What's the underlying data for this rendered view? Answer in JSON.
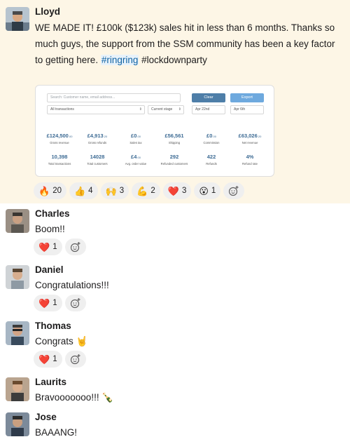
{
  "messages": [
    {
      "author": "Lloyd",
      "text_parts": [
        "WE MADE IT! £100k ($123k) sales hit in less than 6 months. Thanks so much guys, the support from the SSM community has been a key factor to getting here. ",
        "#ringring",
        " #lockdownparty"
      ],
      "attachment": {
        "search_placeholder": "Search: Customer name, email address...",
        "clear_label": "Clear",
        "export_label": "Export",
        "filter_transactions": "All transactions",
        "filter_stage": "Current stage",
        "date_from": "Apr 22nd",
        "date_to": "Apr 6th",
        "stats_row1": [
          {
            "value": "£124,500",
            "suffix": ".00",
            "label": "Gross revenue"
          },
          {
            "value": "£4,913",
            "suffix": ".20",
            "label": "Gross refunds"
          },
          {
            "value": "£0",
            "suffix": ".00",
            "label": "Sales tax"
          },
          {
            "value": "£56,561",
            "suffix": "",
            "label": "Shipping"
          },
          {
            "value": "£0",
            "suffix": ".00",
            "label": "Commission"
          },
          {
            "value": "£63,026",
            "suffix": ".20",
            "label": "Net revenue"
          }
        ],
        "stats_row2": [
          {
            "value": "10,398",
            "suffix": "",
            "label": "Total transactions"
          },
          {
            "value": "14028",
            "suffix": "",
            "label": "Total customers"
          },
          {
            "value": "£4",
            "suffix": ".00",
            "label": "Avg. order value"
          },
          {
            "value": "292",
            "suffix": "",
            "label": "Refunded customers"
          },
          {
            "value": "422",
            "suffix": "",
            "label": "Refunds"
          },
          {
            "value": "4%",
            "suffix": "",
            "label": "Refund rate"
          }
        ]
      },
      "reactions": [
        {
          "emoji": "🔥",
          "count": "20"
        },
        {
          "emoji": "👍",
          "count": "4"
        },
        {
          "emoji": "🙌",
          "count": "3"
        },
        {
          "emoji": "💪",
          "count": "2"
        },
        {
          "emoji": "❤️",
          "count": "3"
        },
        {
          "emoji": "😮",
          "count": "1"
        }
      ]
    },
    {
      "author": "Charles",
      "text": "Boom!!",
      "reactions": [
        {
          "emoji": "❤️",
          "count": "1"
        }
      ]
    },
    {
      "author": "Daniel",
      "text": "Congratulations!!!",
      "reactions": [
        {
          "emoji": "❤️",
          "count": "1"
        }
      ]
    },
    {
      "author": "Thomas",
      "text": "Congrats",
      "text_emoji": "🤘",
      "reactions": [
        {
          "emoji": "❤️",
          "count": "1"
        }
      ]
    },
    {
      "author": "Laurits",
      "text": "Bravooooooo!!!",
      "text_emoji": "🍾"
    },
    {
      "author": "Jose",
      "text": "BAAANG!"
    }
  ],
  "colors": {
    "highlight_bg": "#fdf6e6",
    "link": "#1264a3",
    "reaction_bg": "#efefef"
  },
  "icons": {
    "add_reaction": "add-reaction-icon"
  }
}
